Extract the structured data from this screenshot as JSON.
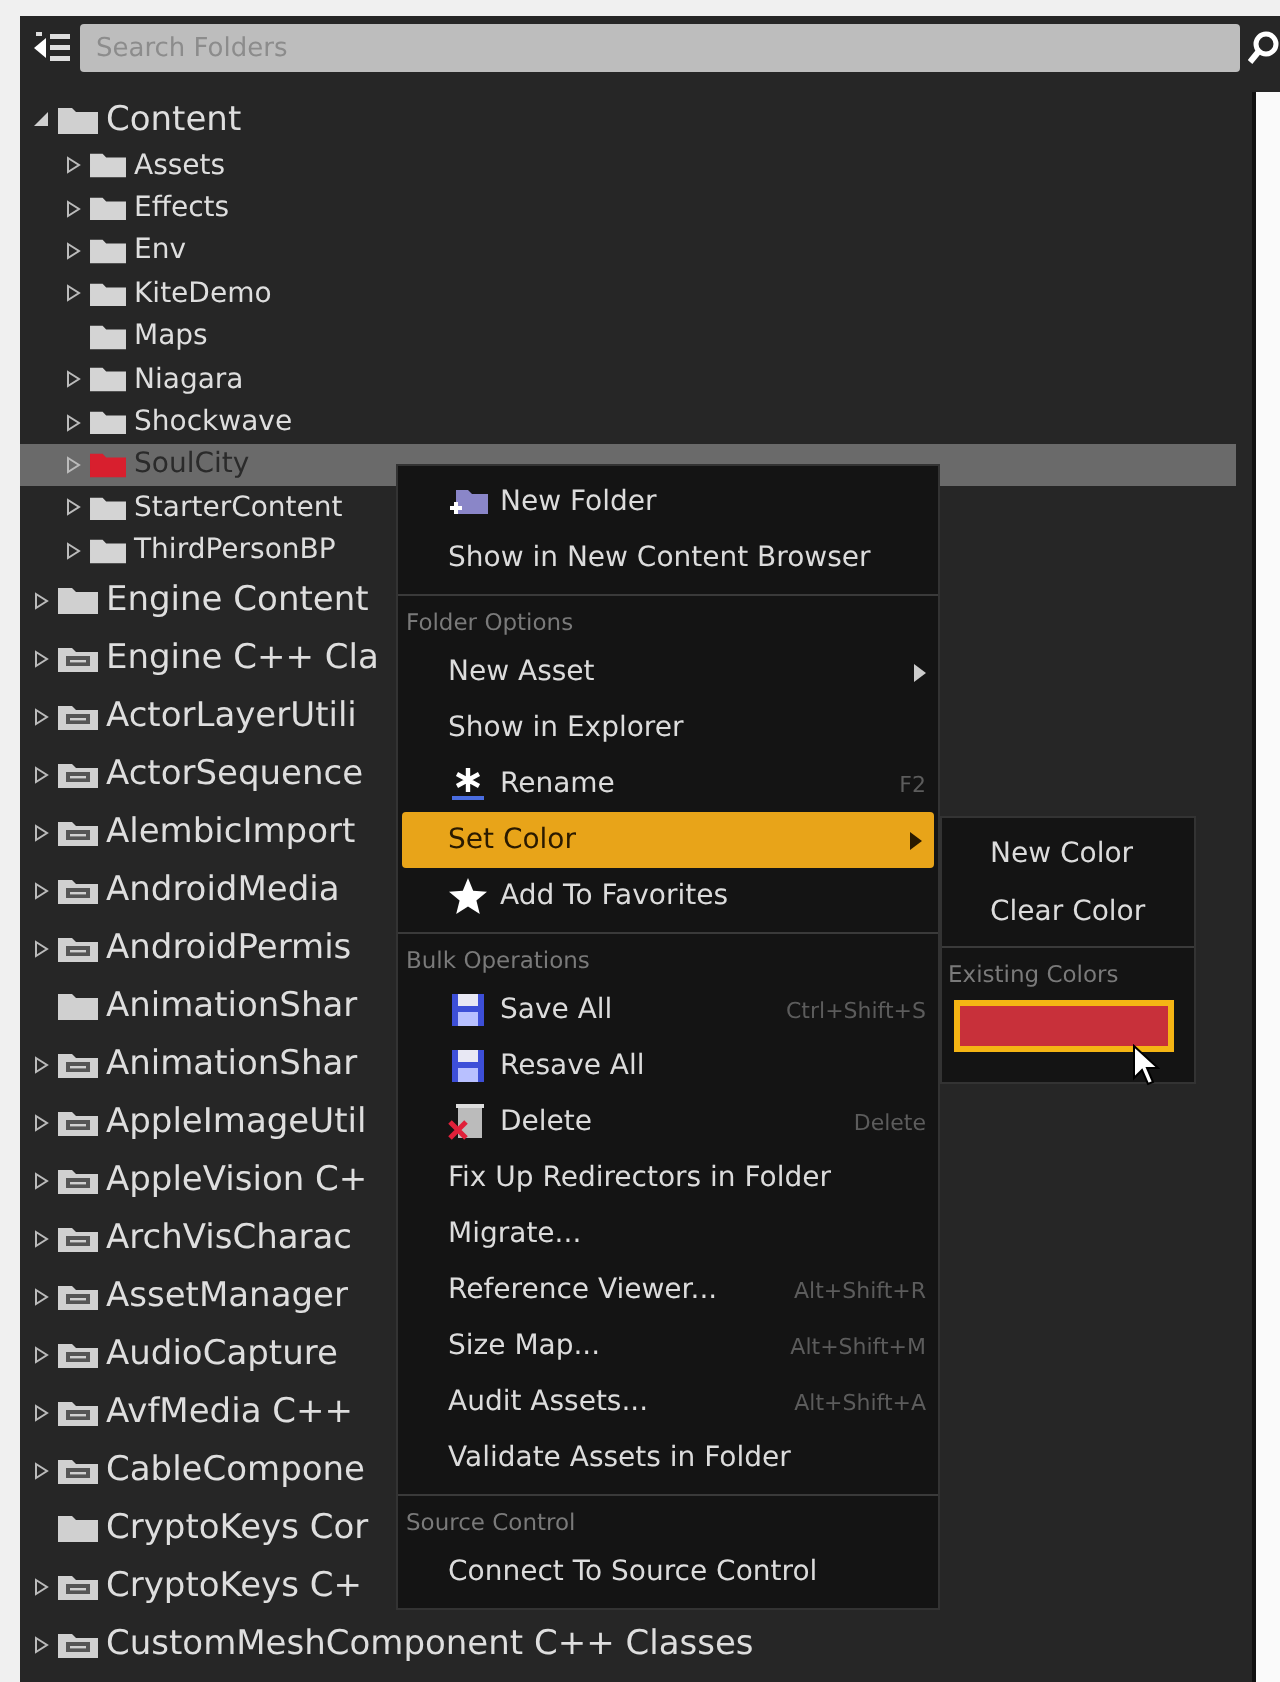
{
  "search": {
    "placeholder": "Search Folders"
  },
  "folders": [
    {
      "label": "Content",
      "kind": "folder",
      "expanded": true,
      "selected": false,
      "children": [
        {
          "label": "Assets",
          "color": "#d4d4d4",
          "expanded": false,
          "selected": false
        },
        {
          "label": "Effects",
          "color": "#d4d4d4",
          "expanded": false,
          "selected": false
        },
        {
          "label": "Env",
          "color": "#d4d4d4",
          "expanded": false,
          "selected": false
        },
        {
          "label": "KiteDemo",
          "color": "#d4d4d4",
          "expanded": false,
          "selected": false
        },
        {
          "label": "Maps",
          "color": "#d4d4d4",
          "selected": false
        },
        {
          "label": "Niagara",
          "color": "#d4d4d4",
          "expanded": false,
          "selected": false
        },
        {
          "label": "Shockwave",
          "color": "#d4d4d4",
          "expanded": false,
          "selected": false
        },
        {
          "label": "SoulCity",
          "color": "#d81f2e",
          "expanded": false,
          "selected": true
        },
        {
          "label": "StarterContent",
          "color": "#d4d4d4",
          "expanded": false,
          "selected": false
        },
        {
          "label": "ThirdPersonBP",
          "color": "#d4d4d4",
          "expanded": false,
          "selected": false
        }
      ]
    },
    {
      "label": "Engine Content",
      "kind": "folder",
      "expanded": false,
      "selected": false
    },
    {
      "label": "Engine C++ Cla",
      "kind": "cpp",
      "expanded": false,
      "selected": false
    },
    {
      "label": "ActorLayerUtili",
      "kind": "cpp",
      "expanded": false,
      "selected": false
    },
    {
      "label": "ActorSequence",
      "kind": "cpp",
      "expanded": false,
      "selected": false
    },
    {
      "label": "AlembicImport",
      "kind": "cpp",
      "expanded": false,
      "selected": false
    },
    {
      "label": "AndroidMedia",
      "kind": "cpp",
      "expanded": false,
      "selected": false
    },
    {
      "label": "AndroidPermis",
      "kind": "cpp",
      "expanded": false,
      "selected": false
    },
    {
      "label": "AnimationShar",
      "kind": "folder",
      "selected": false
    },
    {
      "label": "AnimationShar",
      "kind": "cpp",
      "expanded": false,
      "selected": false
    },
    {
      "label": "AppleImageUtil",
      "kind": "cpp",
      "expanded": false,
      "selected": false
    },
    {
      "label": "AppleVision C+",
      "kind": "cpp",
      "expanded": false,
      "selected": false
    },
    {
      "label": "ArchVisCharac",
      "kind": "cpp",
      "expanded": false,
      "selected": false
    },
    {
      "label": "AssetManager",
      "kind": "cpp",
      "expanded": false,
      "selected": false
    },
    {
      "label": "AudioCapture",
      "kind": "cpp",
      "expanded": false,
      "selected": false
    },
    {
      "label": "AvfMedia C++",
      "kind": "cpp",
      "expanded": false,
      "selected": false
    },
    {
      "label": "CableCompone",
      "kind": "cpp",
      "expanded": false,
      "selected": false
    },
    {
      "label": "CryptoKeys Cor",
      "kind": "folder",
      "selected": false
    },
    {
      "label": "CryptoKeys C+",
      "kind": "cpp",
      "expanded": false,
      "selected": false
    },
    {
      "label": "CustomMeshComponent C++ Classes",
      "kind": "cpp",
      "expanded": false,
      "selected": false
    }
  ],
  "context_menu": {
    "sections": [
      {
        "items": [
          {
            "label": "New Folder",
            "kind": "new_folder",
            "has_submenu": false,
            "selected": false
          },
          {
            "label": "Show in New Content Browser",
            "kind": "plain",
            "has_submenu": false,
            "selected": false
          }
        ]
      },
      {
        "header": "Folder Options",
        "items": [
          {
            "label": "New Asset",
            "kind": "plain",
            "has_submenu": true,
            "selected": false
          },
          {
            "label": "Show in Explorer",
            "kind": "plain",
            "has_submenu": false,
            "selected": false
          },
          {
            "label": "Rename",
            "kind": "rename",
            "shortcut": "F2",
            "has_submenu": false,
            "selected": false
          },
          {
            "label": "Set Color",
            "kind": "plain",
            "has_submenu": true,
            "selected": true
          },
          {
            "label": "Add To Favorites",
            "kind": "favorite",
            "has_submenu": false,
            "selected": false
          }
        ]
      },
      {
        "header": "Bulk Operations",
        "items": [
          {
            "label": "Save All",
            "kind": "save",
            "shortcut": "Ctrl+Shift+S",
            "has_submenu": false,
            "selected": false
          },
          {
            "label": "Resave All",
            "kind": "save",
            "has_submenu": false,
            "selected": false
          },
          {
            "label": "Delete",
            "kind": "delete",
            "shortcut": "Delete",
            "has_submenu": false,
            "selected": false
          },
          {
            "label": "Fix Up Redirectors in Folder",
            "kind": "plain",
            "has_submenu": false,
            "selected": false
          },
          {
            "label": "Migrate...",
            "kind": "plain",
            "has_submenu": false,
            "selected": false
          },
          {
            "label": "Reference Viewer...",
            "kind": "plain",
            "shortcut": "Alt+Shift+R",
            "has_submenu": false,
            "selected": false
          },
          {
            "label": "Size Map...",
            "kind": "plain",
            "shortcut": "Alt+Shift+M",
            "has_submenu": false,
            "selected": false
          },
          {
            "label": "Audit Assets...",
            "kind": "plain",
            "shortcut": "Alt+Shift+A",
            "has_submenu": false,
            "selected": false
          },
          {
            "label": "Validate Assets in Folder",
            "kind": "plain",
            "has_submenu": false,
            "selected": false
          }
        ]
      },
      {
        "header": "Source Control",
        "items": [
          {
            "label": "Connect To Source Control",
            "kind": "plain",
            "has_submenu": false,
            "selected": false
          }
        ]
      }
    ]
  },
  "color_submenu": {
    "items": [
      {
        "label": "New Color"
      },
      {
        "label": "Clear Color"
      }
    ],
    "header": "Existing Colors",
    "swatches": [
      {
        "color": "#c8303a",
        "selected": true
      }
    ]
  }
}
